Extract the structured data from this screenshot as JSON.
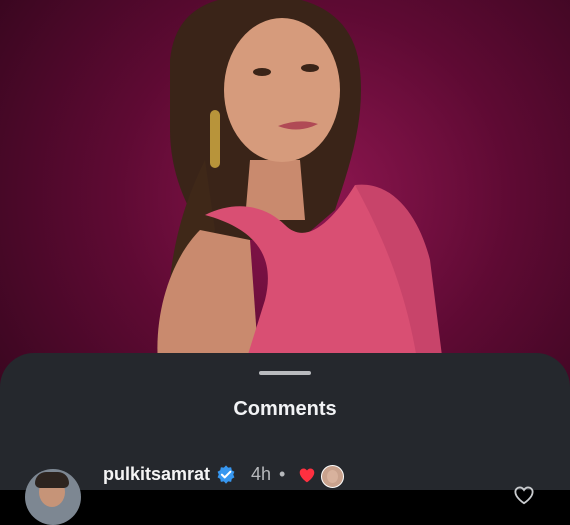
{
  "sheet": {
    "title": "Comments"
  },
  "comment": {
    "username": "pulkitsamrat",
    "time": "4h",
    "separator": "•",
    "reaction": "heart"
  },
  "colors": {
    "backdrop": "#7a0f43",
    "sheet": "#25282d",
    "verified": "#3797f0",
    "heart": "#ff3040"
  }
}
